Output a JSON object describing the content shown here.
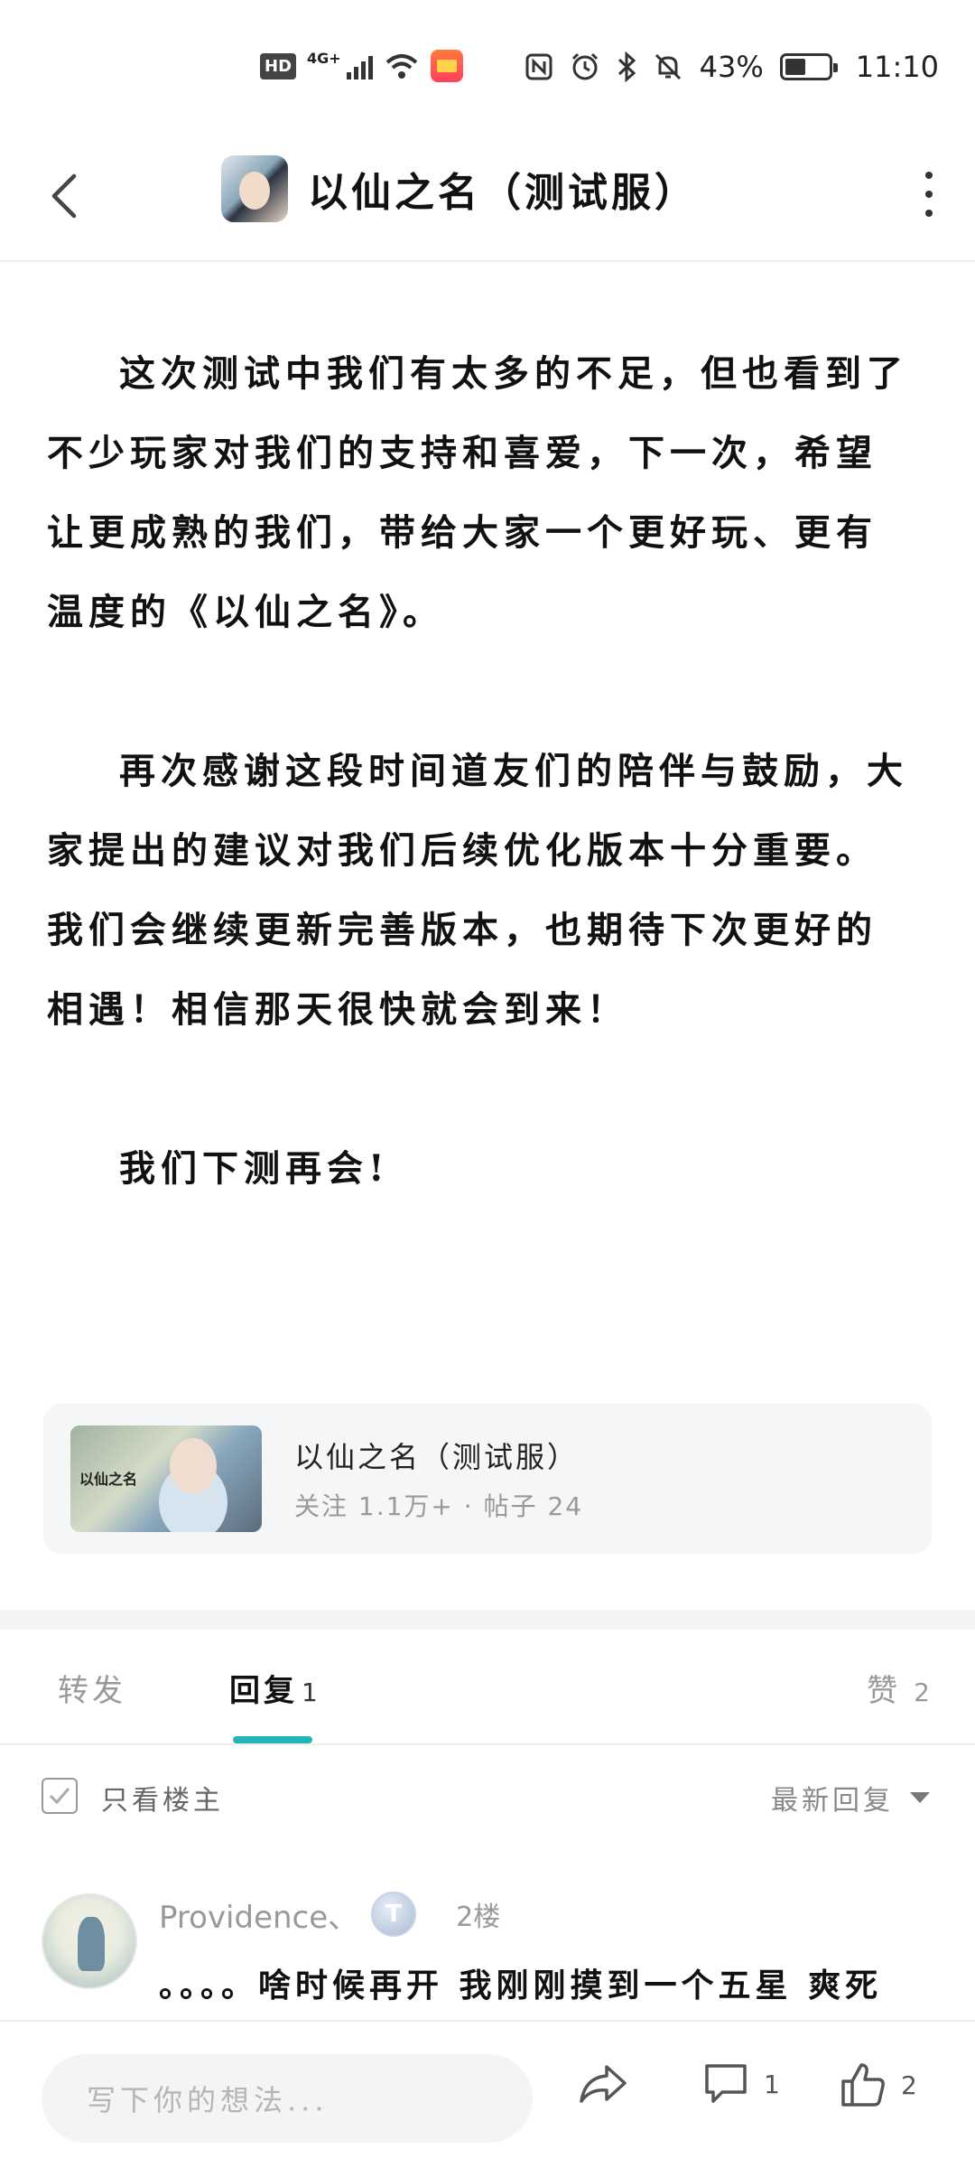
{
  "status_bar": {
    "network": "HD",
    "signal": "4G+",
    "battery": "43%",
    "time": "11:10"
  },
  "nav": {
    "title": "以仙之名（测试服）"
  },
  "article": {
    "paragraphs": [
      "这次测试中我们有太多的不足，但也看到了不少玩家对我们的支持和喜爱，下一次，希望让更成熟的我们，带给大家一个更好玩、更有温度的《以仙之名》。",
      "再次感谢这段时间道友们的陪伴与鼓励，大家提出的建议对我们后续优化版本十分重要。我们会继续更新完善版本，也期待下次更好的相遇！相信那天很快就会到来！",
      "我们下测再会!"
    ]
  },
  "forum_card": {
    "name": "以仙之名（测试服）",
    "stats": "关注 1.1万+ · 帖子 24"
  },
  "tabs": {
    "repost": "转发",
    "reply": "回复",
    "reply_count": "1",
    "like": "赞",
    "like_count": "2"
  },
  "filter": {
    "only_op": "只看楼主",
    "sort": "最新回复"
  },
  "reply": {
    "username": "Providence、",
    "level_badge": "T",
    "floor": "2楼",
    "text": "。。。。啥时候再开 我刚刚摸到一个五星 爽死了啊"
  },
  "bottom_bar": {
    "input_placeholder": "写下你的想法...",
    "comment_count": "1",
    "like_count": "2"
  }
}
